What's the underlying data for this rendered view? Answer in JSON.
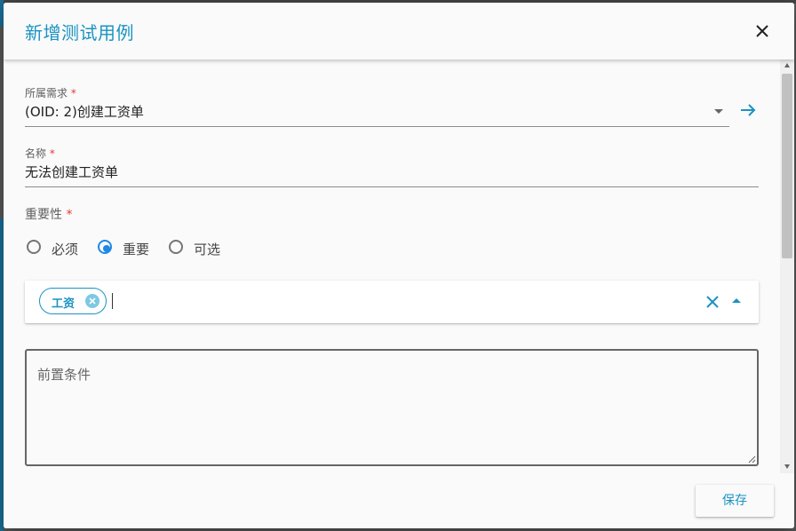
{
  "dialog": {
    "title": "新增测试用例",
    "close_icon": "close-icon"
  },
  "form": {
    "requirement": {
      "label": "所属需求",
      "required_mark": "*",
      "value": "(OID: 2)创建工资单",
      "dropdown_icon": "arrow-drop-down-icon",
      "goto_icon": "arrow-right-icon"
    },
    "name": {
      "label": "名称",
      "required_mark": "*",
      "value": "无法创建工资单"
    },
    "importance": {
      "label": "重要性",
      "required_mark": "*",
      "options": [
        "必须",
        "重要",
        "可选"
      ],
      "selected": "重要"
    },
    "tags": {
      "chips": [
        "工资"
      ],
      "clear_icon": "close-icon",
      "toggle_icon": "arrow-drop-up-icon"
    },
    "precondition": {
      "placeholder": "前置条件"
    }
  },
  "footer": {
    "save_label": "保存"
  },
  "colors": {
    "accent": "#1a93c2",
    "radio_selected": "#1e88e5",
    "required": "#e53935"
  }
}
